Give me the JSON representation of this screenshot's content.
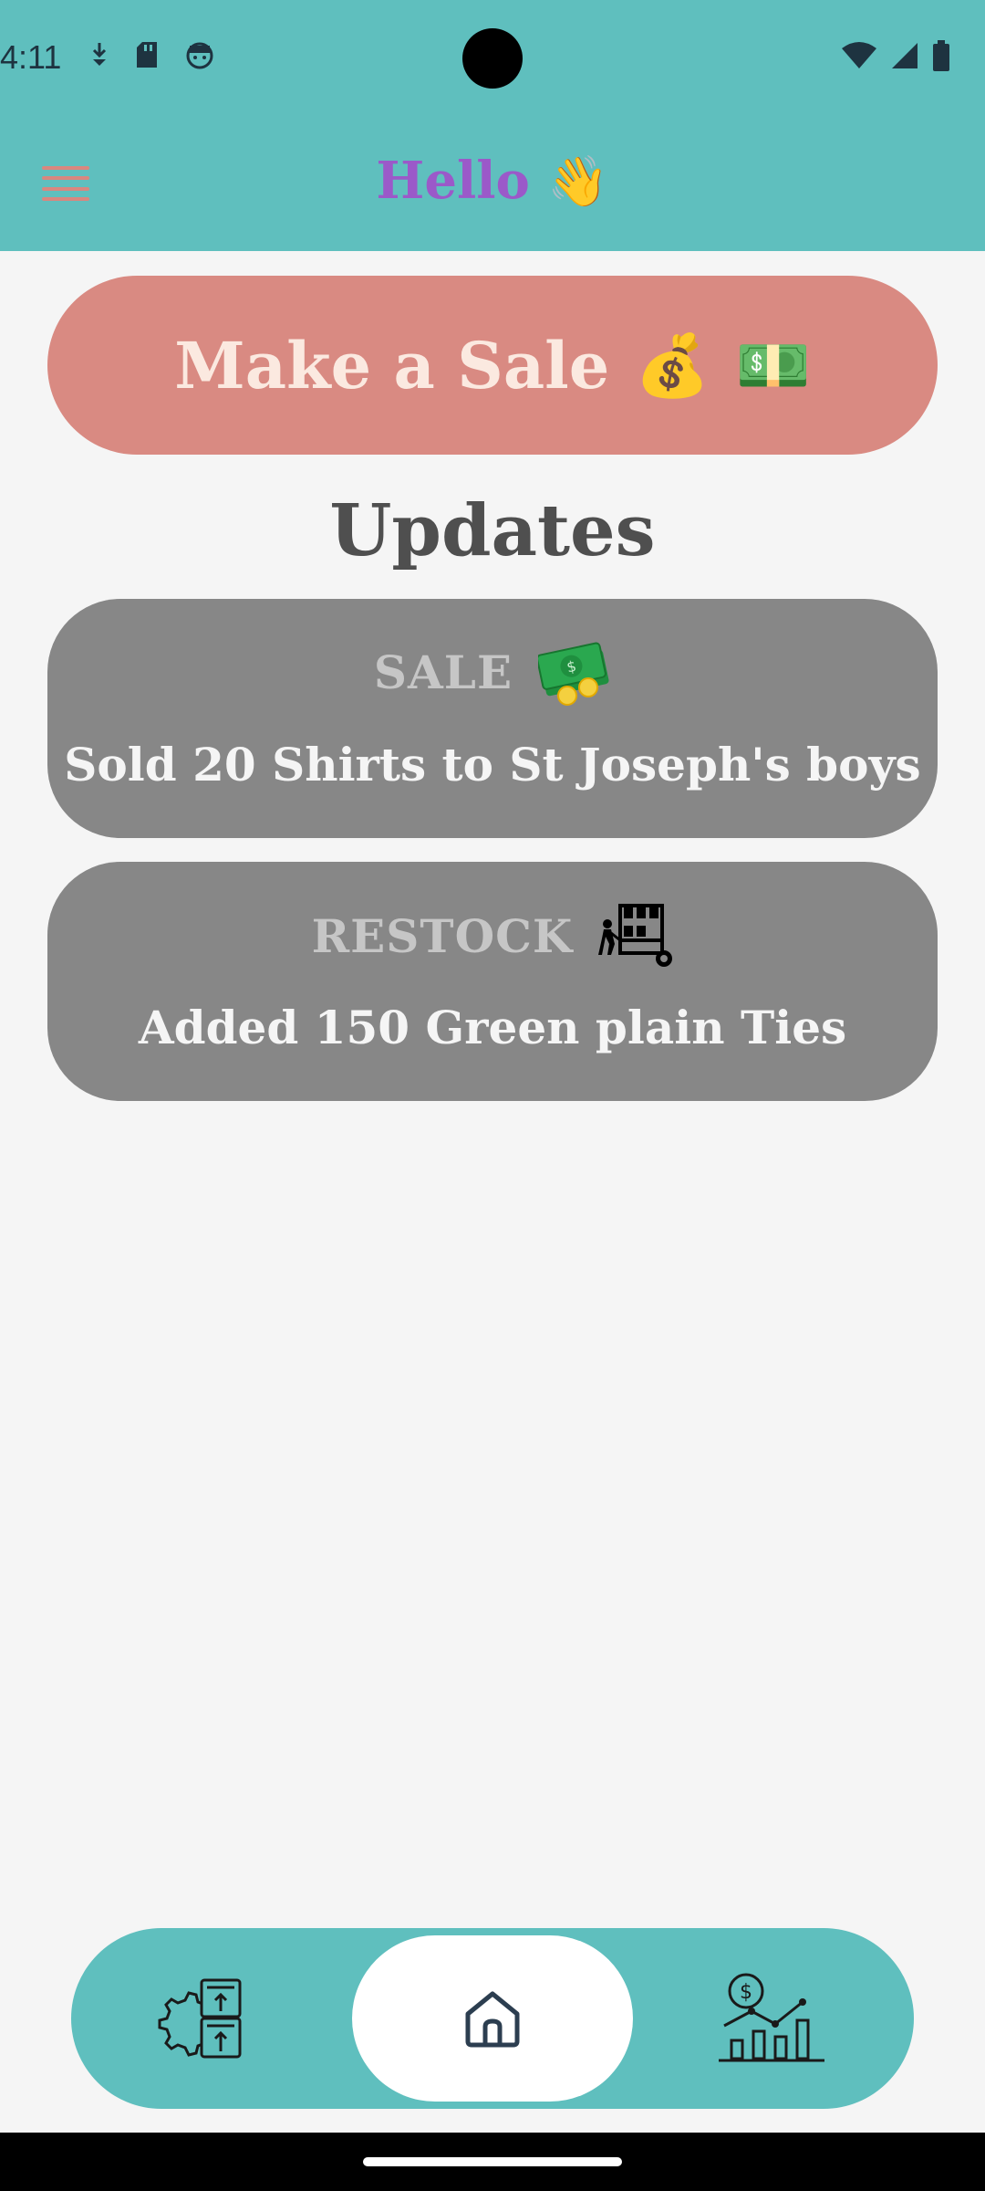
{
  "status_bar": {
    "time": "4:11"
  },
  "header": {
    "title": "Hello",
    "title_emoji": "👋",
    "menu_icon": "hamburger-menu-icon"
  },
  "sale_button": {
    "label": "Make a Sale",
    "emoji_1": "💰",
    "emoji_2": "💵"
  },
  "updates": {
    "title": "Updates",
    "items": [
      {
        "type": "SALE",
        "icon": "cash-coins-icon",
        "description": "Sold 20 Shirts to St Joseph's boys"
      },
      {
        "type": "RESTOCK",
        "icon": "warehouse-trolley-icon",
        "description": "Added 150 Green plain Ties"
      }
    ]
  },
  "bottom_nav": {
    "items": [
      {
        "name": "inventory",
        "icon": "inventory-settings-icon",
        "selected": false
      },
      {
        "name": "home",
        "icon": "home-icon",
        "selected": true
      },
      {
        "name": "statistics",
        "icon": "sales-chart-icon",
        "selected": false
      }
    ]
  },
  "colors": {
    "header_bg": "#5fbfbe",
    "sale_button_bg": "#d98a82",
    "card_bg": "#878787",
    "title_purple": "#9b59c9",
    "page_bg": "#f5f5f5"
  }
}
